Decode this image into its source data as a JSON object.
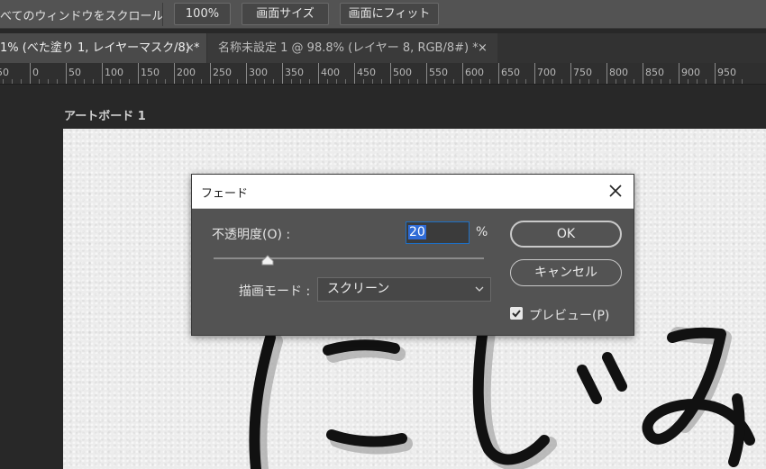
{
  "options_bar": {
    "scroll_all_label": "べてのウィンドウをスクロール",
    "zoom_100_label": "100%",
    "fit_screen_size_label": "画面サイズ",
    "fit_screen_label": "画面にフィット"
  },
  "tabs": [
    {
      "label": "1% (べた塗り 1, レイヤーマスク/8) *",
      "close": "×"
    },
    {
      "label": "名称未設定 1 @ 98.8% (レイヤー 8, RGB/8#) *",
      "close": "×"
    }
  ],
  "ruler": {
    "labels": [
      "50",
      "0",
      "50",
      "100",
      "150",
      "200",
      "250",
      "300",
      "350",
      "400",
      "450",
      "500",
      "550",
      "600",
      "650",
      "700",
      "750",
      "800",
      "850",
      "900",
      "950"
    ]
  },
  "artboard": {
    "title": "アートボード 1"
  },
  "dialog": {
    "title": "フェード",
    "opacity_label": "不透明度(O) :",
    "opacity_value": "20",
    "opacity_percent_sign": "%",
    "opacity_level_percent": 20,
    "mode_label": "描画モード :",
    "mode_value": "スクリーン",
    "ok_label": "OK",
    "cancel_label": "キャンセル",
    "preview_label": "プレビュー(P)",
    "preview_checked": true
  },
  "colors": {
    "panel": "#535353",
    "workspace": "#282828",
    "focus": "#1e6fc4",
    "paper": "#ececec"
  }
}
